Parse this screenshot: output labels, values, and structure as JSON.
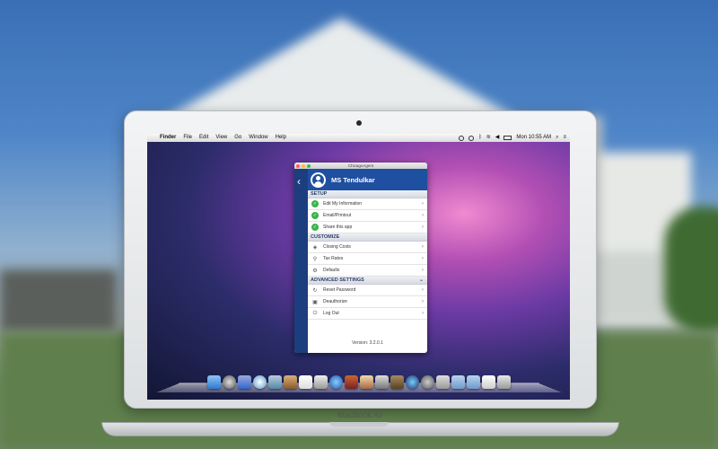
{
  "laptop": {
    "label": "MacBook Air"
  },
  "menubar": {
    "items": [
      "Finder",
      "File",
      "Edit",
      "View",
      "Go",
      "Window",
      "Help"
    ],
    "clock": "Mon 10:55 AM"
  },
  "app": {
    "window_title": "ChicagoAgent",
    "user_name": "MS Tendulkar",
    "sections": [
      {
        "title": "SETUP",
        "items": [
          "Edit My Information",
          "Email/Printout",
          "Share this app"
        ]
      },
      {
        "title": "CUSTOMIZE",
        "items": [
          "Closing Costs",
          "Tax Rates",
          "Defaults"
        ]
      },
      {
        "title": "ADVANCED SETTINGS",
        "items": [
          "Reset Password",
          "Deauthorize",
          "Log Out"
        ]
      }
    ],
    "version": "Version: 3.2.0.1"
  },
  "icons": {
    "back": "chevron-left-icon",
    "check": "check-circle-icon",
    "closing_costs": "tag-icon",
    "tax_rates": "location-pin-icon",
    "defaults": "gear-icon",
    "reset_password": "refresh-icon",
    "deauthorize": "lock-icon",
    "log_out": "power-icon"
  },
  "colors": {
    "header": "#1f4fa0",
    "sidebar": "#1c3e7f",
    "check": "#39b54a"
  }
}
